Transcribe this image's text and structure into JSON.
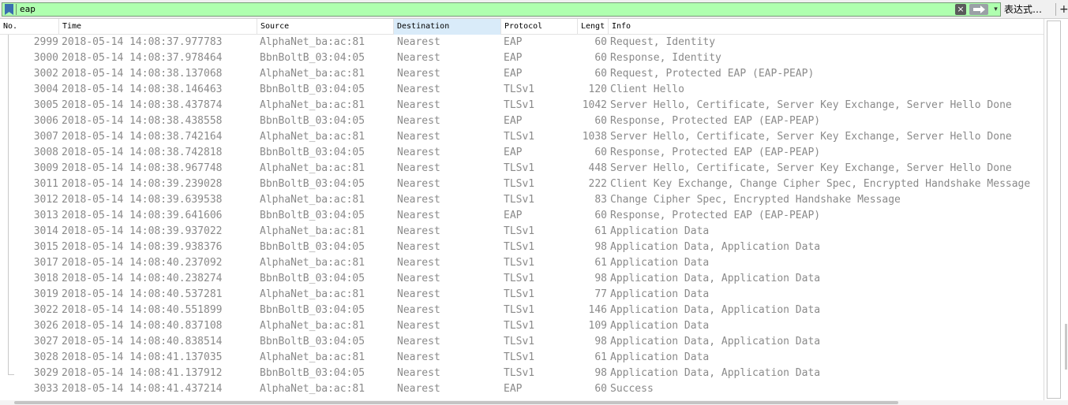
{
  "filter": {
    "value": "eap",
    "clear_icon": "×",
    "dropdown_icon": "▾",
    "expression_label": "表达式…",
    "add_label": "+"
  },
  "columns": {
    "no": "No.",
    "time": "Time",
    "source": "Source",
    "destination": "Destination",
    "protocol": "Protocol",
    "length": "Lengt",
    "info": "Info"
  },
  "packets": [
    {
      "no": "2999",
      "time": "2018-05-14 14:08:37.977783",
      "source": "AlphaNet_ba:ac:81",
      "destination": "Nearest",
      "protocol": "EAP",
      "length": "60",
      "info": "Request, Identity"
    },
    {
      "no": "3000",
      "time": "2018-05-14 14:08:37.978464",
      "source": "BbnBoltB_03:04:05",
      "destination": "Nearest",
      "protocol": "EAP",
      "length": "60",
      "info": "Response, Identity"
    },
    {
      "no": "3002",
      "time": "2018-05-14 14:08:38.137068",
      "source": "AlphaNet_ba:ac:81",
      "destination": "Nearest",
      "protocol": "EAP",
      "length": "60",
      "info": "Request, Protected EAP (EAP-PEAP)"
    },
    {
      "no": "3004",
      "time": "2018-05-14 14:08:38.146463",
      "source": "BbnBoltB_03:04:05",
      "destination": "Nearest",
      "protocol": "TLSv1",
      "length": "120",
      "info": "Client Hello"
    },
    {
      "no": "3005",
      "time": "2018-05-14 14:08:38.437874",
      "source": "AlphaNet_ba:ac:81",
      "destination": "Nearest",
      "protocol": "TLSv1",
      "length": "1042",
      "info": "Server Hello, Certificate, Server Key Exchange, Server Hello Done"
    },
    {
      "no": "3006",
      "time": "2018-05-14 14:08:38.438558",
      "source": "BbnBoltB_03:04:05",
      "destination": "Nearest",
      "protocol": "EAP",
      "length": "60",
      "info": "Response, Protected EAP (EAP-PEAP)"
    },
    {
      "no": "3007",
      "time": "2018-05-14 14:08:38.742164",
      "source": "AlphaNet_ba:ac:81",
      "destination": "Nearest",
      "protocol": "TLSv1",
      "length": "1038",
      "info": "Server Hello, Certificate, Server Key Exchange, Server Hello Done"
    },
    {
      "no": "3008",
      "time": "2018-05-14 14:08:38.742818",
      "source": "BbnBoltB_03:04:05",
      "destination": "Nearest",
      "protocol": "EAP",
      "length": "60",
      "info": "Response, Protected EAP (EAP-PEAP)"
    },
    {
      "no": "3009",
      "time": "2018-05-14 14:08:38.967748",
      "source": "AlphaNet_ba:ac:81",
      "destination": "Nearest",
      "protocol": "TLSv1",
      "length": "448",
      "info": "Server Hello, Certificate, Server Key Exchange, Server Hello Done"
    },
    {
      "no": "3011",
      "time": "2018-05-14 14:08:39.239028",
      "source": "BbnBoltB_03:04:05",
      "destination": "Nearest",
      "protocol": "TLSv1",
      "length": "222",
      "info": "Client Key Exchange, Change Cipher Spec, Encrypted Handshake Message"
    },
    {
      "no": "3012",
      "time": "2018-05-14 14:08:39.639538",
      "source": "AlphaNet_ba:ac:81",
      "destination": "Nearest",
      "protocol": "TLSv1",
      "length": "83",
      "info": "Change Cipher Spec, Encrypted Handshake Message"
    },
    {
      "no": "3013",
      "time": "2018-05-14 14:08:39.641606",
      "source": "BbnBoltB_03:04:05",
      "destination": "Nearest",
      "protocol": "EAP",
      "length": "60",
      "info": "Response, Protected EAP (EAP-PEAP)"
    },
    {
      "no": "3014",
      "time": "2018-05-14 14:08:39.937022",
      "source": "AlphaNet_ba:ac:81",
      "destination": "Nearest",
      "protocol": "TLSv1",
      "length": "61",
      "info": "Application Data"
    },
    {
      "no": "3015",
      "time": "2018-05-14 14:08:39.938376",
      "source": "BbnBoltB_03:04:05",
      "destination": "Nearest",
      "protocol": "TLSv1",
      "length": "98",
      "info": "Application Data, Application Data"
    },
    {
      "no": "3017",
      "time": "2018-05-14 14:08:40.237092",
      "source": "AlphaNet_ba:ac:81",
      "destination": "Nearest",
      "protocol": "TLSv1",
      "length": "61",
      "info": "Application Data"
    },
    {
      "no": "3018",
      "time": "2018-05-14 14:08:40.238274",
      "source": "BbnBoltB_03:04:05",
      "destination": "Nearest",
      "protocol": "TLSv1",
      "length": "98",
      "info": "Application Data, Application Data"
    },
    {
      "no": "3019",
      "time": "2018-05-14 14:08:40.537281",
      "source": "AlphaNet_ba:ac:81",
      "destination": "Nearest",
      "protocol": "TLSv1",
      "length": "77",
      "info": "Application Data"
    },
    {
      "no": "3022",
      "time": "2018-05-14 14:08:40.551899",
      "source": "BbnBoltB_03:04:05",
      "destination": "Nearest",
      "protocol": "TLSv1",
      "length": "146",
      "info": "Application Data, Application Data"
    },
    {
      "no": "3026",
      "time": "2018-05-14 14:08:40.837108",
      "source": "AlphaNet_ba:ac:81",
      "destination": "Nearest",
      "protocol": "TLSv1",
      "length": "109",
      "info": "Application Data"
    },
    {
      "no": "3027",
      "time": "2018-05-14 14:08:40.838514",
      "source": "BbnBoltB_03:04:05",
      "destination": "Nearest",
      "protocol": "TLSv1",
      "length": "98",
      "info": "Application Data, Application Data"
    },
    {
      "no": "3028",
      "time": "2018-05-14 14:08:41.137035",
      "source": "AlphaNet_ba:ac:81",
      "destination": "Nearest",
      "protocol": "TLSv1",
      "length": "61",
      "info": "Application Data"
    },
    {
      "no": "3029",
      "time": "2018-05-14 14:08:41.137912",
      "source": "BbnBoltB_03:04:05",
      "destination": "Nearest",
      "protocol": "TLSv1",
      "length": "98",
      "info": "Application Data, Application Data"
    },
    {
      "no": "3033",
      "time": "2018-05-14 14:08:41.437214",
      "source": "AlphaNet_ba:ac:81",
      "destination": "Nearest",
      "protocol": "EAP",
      "length": "60",
      "info": "Success"
    }
  ]
}
